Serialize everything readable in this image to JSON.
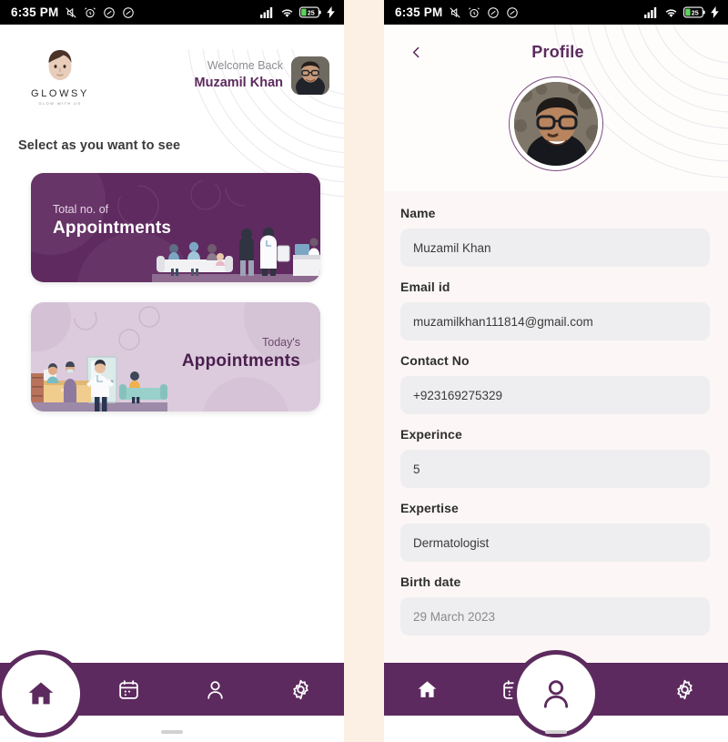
{
  "statusbar": {
    "time": "6:35 PM",
    "left_icons": [
      "mute-icon",
      "alarm-icon",
      "dnd-icon",
      "dnd-secondary-icon"
    ],
    "right_icons": [
      "signal-icon",
      "wifi-icon",
      "battery-icon",
      "charging-bolt-icon"
    ],
    "battery_level": "25"
  },
  "home": {
    "logo": {
      "name": "GLOWSY",
      "tagline": "GLOW WITH US",
      "icon": "face-logo-icon"
    },
    "welcome": {
      "greeting": "Welcome Back",
      "name": "Muzamil Khan",
      "avatar": "user-avatar"
    },
    "section_title": "Select as you want to see",
    "cards": [
      {
        "kicker": "Total no. of",
        "title": "Appointments",
        "variant": "dark",
        "art": "waiting-room-illustration"
      },
      {
        "kicker": "Today's",
        "title": "Appointments",
        "variant": "light",
        "art": "clinic-reception-illustration"
      }
    ],
    "nav": [
      {
        "name": "home",
        "icon": "home-icon",
        "active": true
      },
      {
        "name": "calendar",
        "icon": "calendar-icon",
        "active": false
      },
      {
        "name": "profile",
        "icon": "person-icon",
        "active": false
      },
      {
        "name": "settings",
        "icon": "gear-icon",
        "active": false
      }
    ]
  },
  "profile": {
    "back_icon": "chevron-left-icon",
    "title": "Profile",
    "avatar": "profile-photo",
    "fields": [
      {
        "label": "Name",
        "value": "Muzamil Khan"
      },
      {
        "label": "Email id",
        "value": "muzamilkhan111814@gmail.com"
      },
      {
        "label": "Contact No",
        "value": "+923169275329"
      },
      {
        "label": "Experince",
        "value": "5"
      },
      {
        "label": "Expertise",
        "value": "Dermatologist"
      },
      {
        "label": "Birth date",
        "value": "29 March 2023"
      }
    ],
    "nav": [
      {
        "name": "home",
        "icon": "home-icon",
        "active": false
      },
      {
        "name": "calendar",
        "icon": "calendar-icon",
        "active": false
      },
      {
        "name": "profile",
        "icon": "person-icon",
        "active": true
      },
      {
        "name": "settings",
        "icon": "gear-icon",
        "active": false
      }
    ]
  },
  "colors": {
    "primary_purple": "#5C2A5E",
    "card_dark": "#5F2A5F",
    "card_light": "#DCCBDD",
    "field_bg": "#EEEEF0",
    "page_bg": "#FCF7F6",
    "gap_bg": "#FCEFE4"
  }
}
